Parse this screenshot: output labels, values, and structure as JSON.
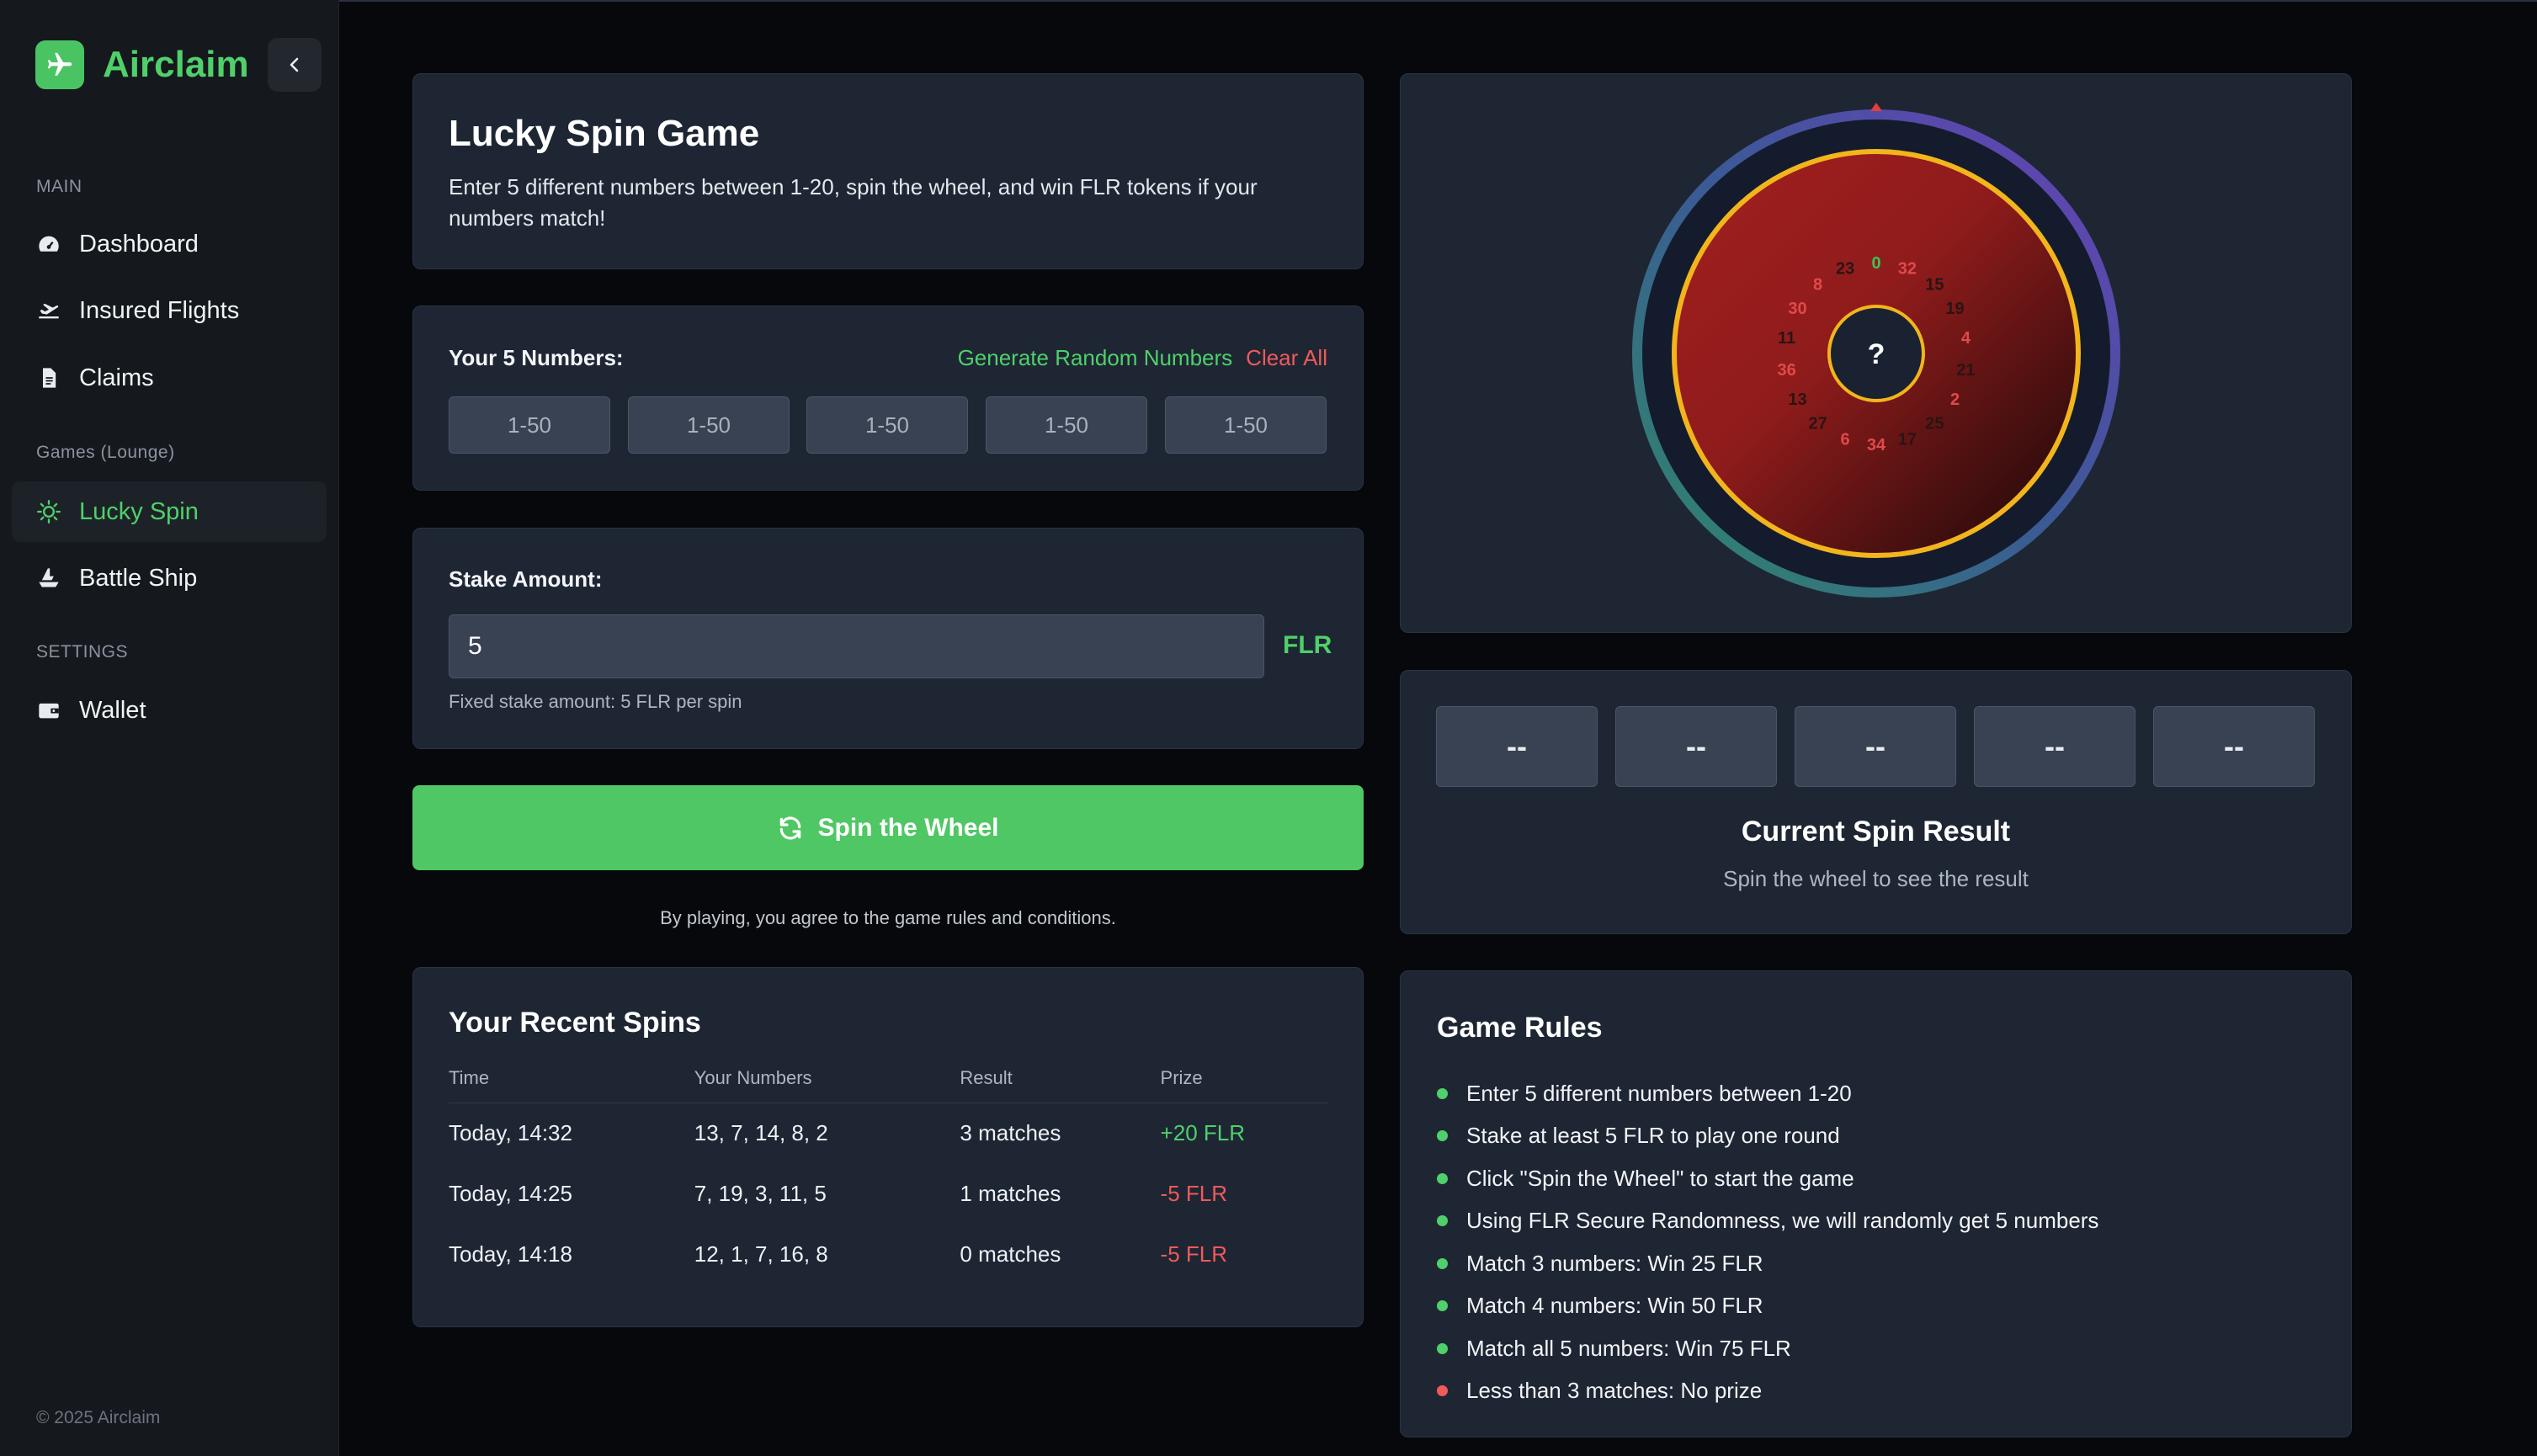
{
  "brand": {
    "name": "Airclaim",
    "accent": "#4fd06a"
  },
  "sidebar": {
    "section_main": "MAIN",
    "section_games": "Games (Lounge)",
    "section_settings": "SETTINGS",
    "items": [
      {
        "label": "Dashboard",
        "icon": "gauge-icon"
      },
      {
        "label": "Insured Flights",
        "icon": "plane-icon"
      },
      {
        "label": "Claims",
        "icon": "document-icon"
      },
      {
        "label": "Lucky Spin",
        "icon": "sun-icon",
        "active": true
      },
      {
        "label": "Battle Ship",
        "icon": "ship-icon"
      },
      {
        "label": "Wallet",
        "icon": "wallet-icon"
      }
    ],
    "footer": "© 2025 Airclaim"
  },
  "intro": {
    "title": "Lucky Spin Game",
    "description": "Enter 5 different numbers between 1-20, spin the wheel, and win FLR tokens if your numbers match!"
  },
  "numbers": {
    "label": "Your 5 Numbers:",
    "generate_label": "Generate Random Numbers",
    "clear_label": "Clear All",
    "placeholders": [
      "1-50",
      "1-50",
      "1-50",
      "1-50",
      "1-50"
    ]
  },
  "stake": {
    "label": "Stake Amount:",
    "value": "5",
    "currency": "FLR",
    "hint": "Fixed stake amount: 5 FLR per spin"
  },
  "spin_button": {
    "label": "Spin the Wheel"
  },
  "agree_text": "By playing, you agree to the game rules and conditions.",
  "recent": {
    "title": "Your Recent Spins",
    "columns": [
      "Time",
      "Your Numbers",
      "Result",
      "Prize"
    ],
    "rows": [
      {
        "time": "Today, 14:32",
        "numbers": "13, 7, 14, 8, 2",
        "result": "3 matches",
        "prize": "+20 FLR"
      },
      {
        "time": "Today, 14:25",
        "numbers": "7, 19, 3, 11, 5",
        "result": "1 matches",
        "prize": "-5 FLR"
      },
      {
        "time": "Today, 14:18",
        "numbers": "12, 1, 7, 16, 8",
        "result": "0 matches",
        "prize": "-5 FLR"
      }
    ]
  },
  "wheel": {
    "center_label": "?",
    "numbers": [
      "0",
      "32",
      "15",
      "19",
      "4",
      "21",
      "2",
      "25",
      "17",
      "34",
      "6",
      "27",
      "13",
      "36",
      "11",
      "30",
      "8",
      "23"
    ],
    "colors": [
      "green",
      "red",
      "black",
      "black",
      "red",
      "black",
      "red",
      "black",
      "black",
      "red",
      "red",
      "black",
      "black",
      "red",
      "black",
      "red",
      "red",
      "black"
    ]
  },
  "result": {
    "slots": [
      "--",
      "--",
      "--",
      "--",
      "--"
    ],
    "title": "Current Spin Result",
    "subtitle": "Spin the wheel to see the result"
  },
  "rules": {
    "title": "Game Rules",
    "items": [
      {
        "text": "Enter 5 different numbers between 1-20",
        "color": "#4fd06a"
      },
      {
        "text": "Stake at least 5 FLR to play one round",
        "color": "#4fd06a"
      },
      {
        "text": "Click \"Spin the Wheel\" to start the game",
        "color": "#4fd06a"
      },
      {
        "text": "Using FLR Secure Randomness, we will randomly get 5 numbers",
        "color": "#4fd06a"
      },
      {
        "text": "Match 3 numbers: Win 25 FLR",
        "color": "#4fd06a"
      },
      {
        "text": "Match 4 numbers: Win 50 FLR",
        "color": "#4fd06a"
      },
      {
        "text": "Match all 5 numbers: Win 75 FLR",
        "color": "#4fd06a"
      },
      {
        "text": "Less than 3 matches: No prize",
        "color": "#ef5a5a"
      }
    ]
  }
}
